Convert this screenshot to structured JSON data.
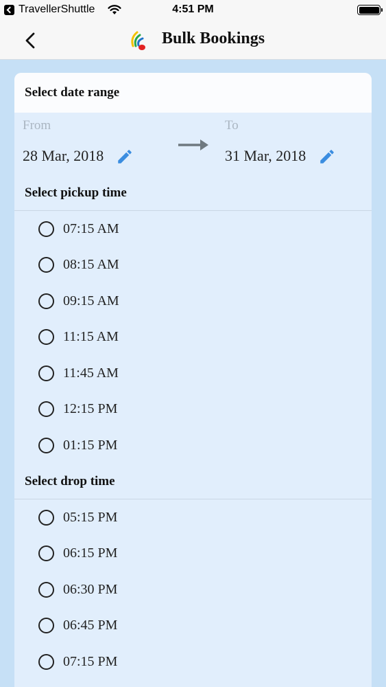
{
  "status_bar": {
    "back_app": "TravellerShuttle",
    "time": "4:51 PM"
  },
  "nav": {
    "title": "Bulk Bookings"
  },
  "date_range": {
    "heading": "Select date range",
    "from_label": "From",
    "from_value": "28 Mar, 2018",
    "to_label": "To",
    "to_value": "31 Mar, 2018"
  },
  "pickup": {
    "heading": "Select pickup time",
    "options": [
      "07:15 AM",
      "08:15 AM",
      "09:15 AM",
      "11:15 AM",
      "11:45 AM",
      "12:15 PM",
      "01:15 PM"
    ]
  },
  "drop": {
    "heading": "Select drop time",
    "options": [
      "05:15 PM",
      "06:15 PM",
      "06:30 PM",
      "06:45 PM",
      "07:15 PM"
    ]
  },
  "colors": {
    "background": "#c6e0f6",
    "card": "#e1eefc",
    "accent": "#3b8de0",
    "arrow": "#6f7980"
  }
}
